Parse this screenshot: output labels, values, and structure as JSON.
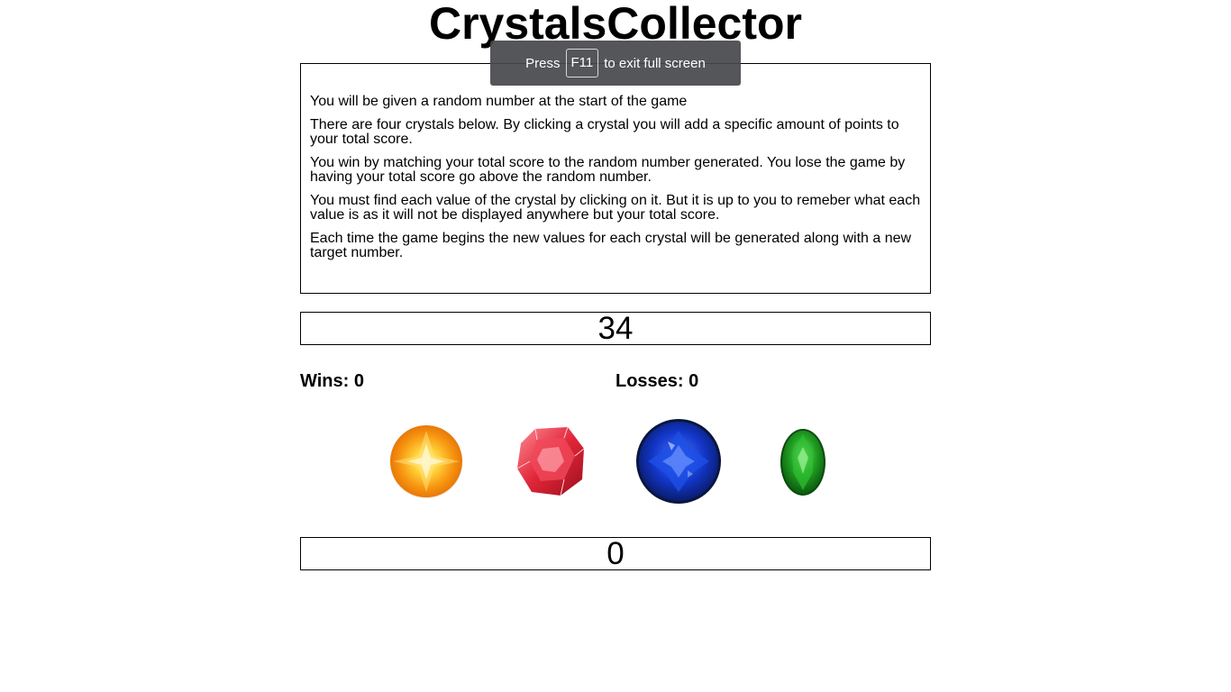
{
  "header": {
    "title": "CrystalsCollector"
  },
  "fullscreen_toast": {
    "prefix": "Press",
    "key": "F11",
    "suffix": "to exit full screen"
  },
  "instructions": [
    "You will be given a random number at the start of the game",
    "There are four crystals below. By clicking a crystal you will add a specific amount of points to your total score.",
    "You win by matching your total score to the random number generated. You lose the game by having your total score go above the random number.",
    "You must find each value of the crystal by clicking on it. But it is up to you to remeber what each value is as it will not be displayed anywhere but your total score.",
    "Each time the game begins the new values for each crystal will be generated along with a new target number."
  ],
  "game": {
    "target_number": "34",
    "wins_text": "Wins: 0",
    "losses_text": "Losses: 0",
    "total_score": "0"
  },
  "crystals": [
    {
      "name": "orange-crystal",
      "color": "#f59a12"
    },
    {
      "name": "red-crystal",
      "color": "#d9283a"
    },
    {
      "name": "blue-crystal",
      "color": "#1336b8"
    },
    {
      "name": "green-crystal",
      "color": "#1f9a1f"
    }
  ]
}
